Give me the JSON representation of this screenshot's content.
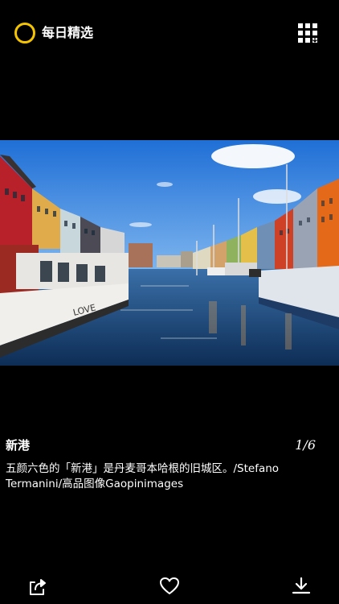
{
  "header": {
    "title": "每日精选",
    "logo_icon": "circle-ring-icon",
    "menu_icon": "grid-icon",
    "accent_color": "#f5c400"
  },
  "photo": {
    "title": "新港",
    "counter": "1/6",
    "description": "五颜六色的「新港」是丹麦哥本哈根的旧城区。/Stefano Termanini/高品图像Gaopinimages",
    "boat_lettering": "LOVE"
  },
  "bottom_bar": {
    "share_icon": "share-icon",
    "like_icon": "heart-icon",
    "download_icon": "download-icon"
  }
}
